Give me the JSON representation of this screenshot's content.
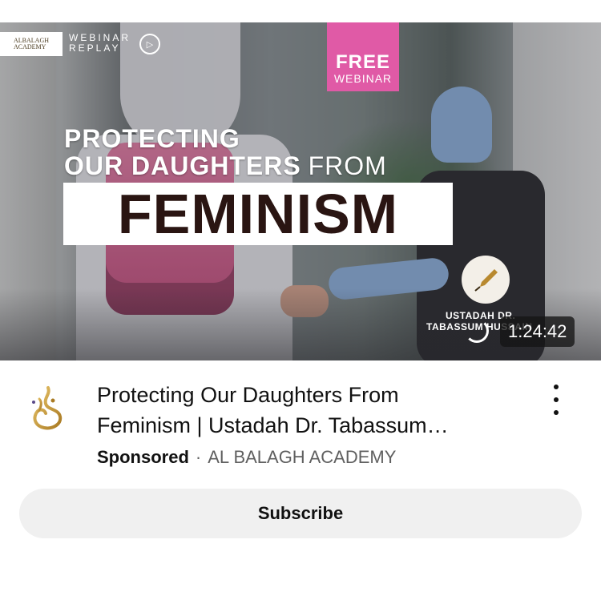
{
  "thumbnail": {
    "logo_text_line1": "ALBALAGH",
    "logo_text_line2": "ACADEMY",
    "replay_line1": "WEBINAR",
    "replay_line2": "REPLAY",
    "badge_big": "FREE",
    "badge_small": "WEBINAR",
    "headline_line1": "PROTECTING",
    "headline_line2_bold": "OUR DAUGHTERS",
    "headline_line2_normal": "FROM",
    "headline_big": "FEMINISM",
    "speaker_line1": "USTADAH DR.",
    "speaker_line2": "TABASSUM HUSSAIN",
    "duration": "1:24:42",
    "pink_accent": "#e05aa6",
    "icons": [
      "play-circle-icon",
      "fountain-pen-icon",
      "loading-spinner-icon"
    ]
  },
  "video": {
    "title_line1": "Protecting Our Daughters From",
    "title_line2": "Feminism | Ustadah Dr. Tabassum…",
    "sponsored_label": "Sponsored",
    "separator": "·",
    "channel_name": "AL BALAGH ACADEMY"
  },
  "actions": {
    "subscribe_label": "Subscribe",
    "more_icon": "more-vertical-icon"
  }
}
